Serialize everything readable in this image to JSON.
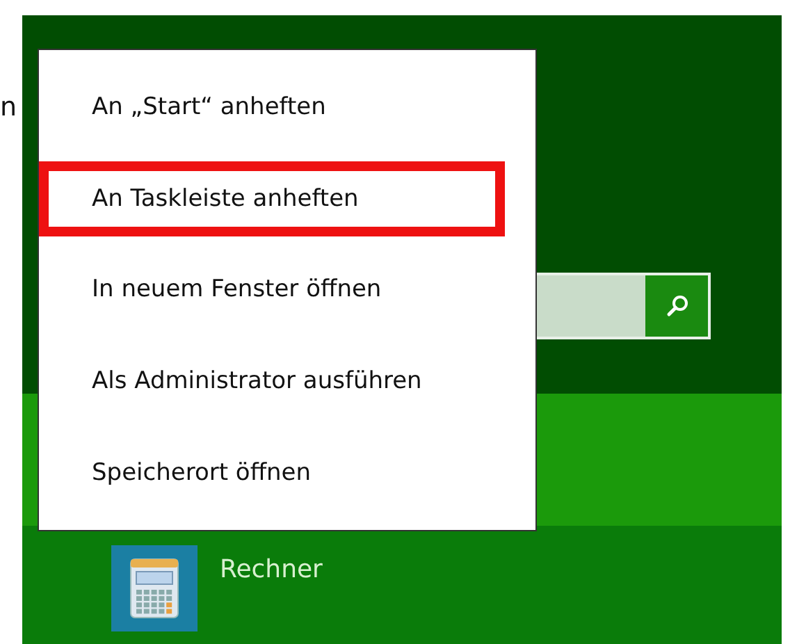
{
  "edge_text": "n",
  "context_menu": {
    "items": [
      {
        "label": "An „Start“ anheften",
        "highlighted": false
      },
      {
        "label": "An Taskleiste anheften",
        "highlighted": true
      },
      {
        "label": "In neuem Fenster öffnen",
        "highlighted": false
      },
      {
        "label": "Als Administrator ausführen",
        "highlighted": false
      },
      {
        "label": "Speicherort öffnen",
        "highlighted": false
      }
    ]
  },
  "app_tile": {
    "name": "Rechner"
  }
}
